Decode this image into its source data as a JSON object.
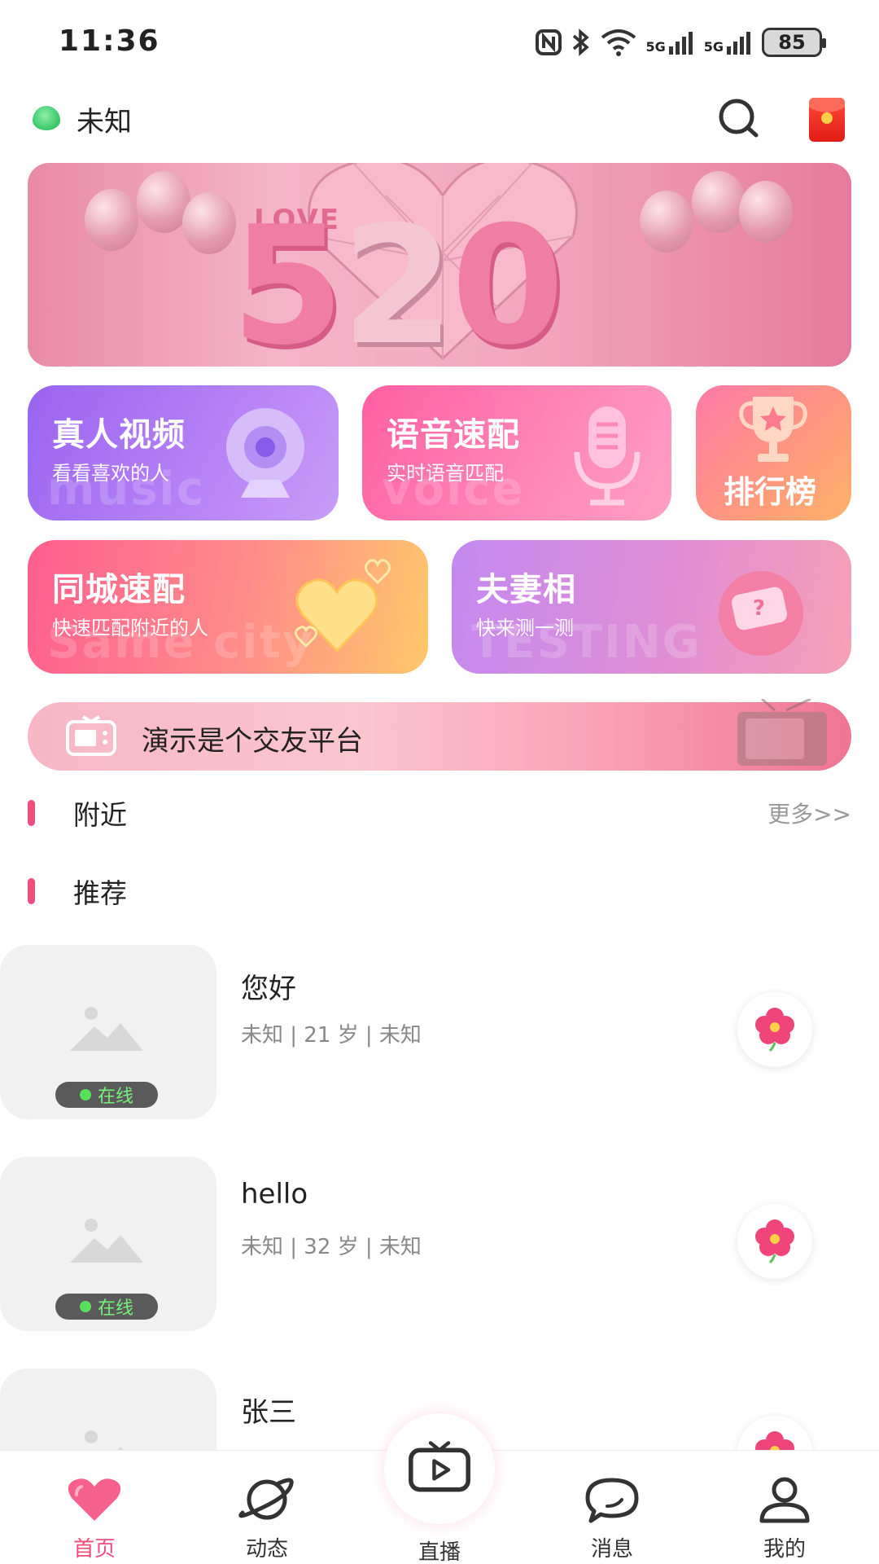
{
  "status_bar": {
    "time": "11:36",
    "network_1": "5G",
    "network_2": "5G",
    "battery": "85"
  },
  "header": {
    "location": "未知"
  },
  "banner": {
    "big_text_a": "5",
    "big_text_b": "2",
    "big_text_c": "0",
    "small_text": "LOVE"
  },
  "features": {
    "video": {
      "title": "真人视频",
      "subtitle": "看看喜欢的人",
      "watermark": "music"
    },
    "voice": {
      "title": "语音速配",
      "subtitle": "实时语音匹配",
      "watermark": "voice"
    },
    "rank": {
      "title": "排行榜"
    },
    "city": {
      "title": "同城速配",
      "subtitle": "快速匹配附近的人",
      "watermark": "Same city"
    },
    "couple": {
      "title": "夫妻相",
      "subtitle": "快来测一测",
      "watermark": "TESTING"
    }
  },
  "notice": {
    "text": "演示是个交友平台"
  },
  "sections": {
    "nearby": {
      "title": "附近",
      "more": "更多>>"
    },
    "recommend": {
      "title": "推荐"
    }
  },
  "users": [
    {
      "name": "您好",
      "meta": "未知 | 21 岁 | 未知",
      "status": "在线"
    },
    {
      "name": "hello",
      "meta": "未知 | 32 岁 | 未知",
      "status": "在线"
    },
    {
      "name": "张三",
      "meta": ""
    }
  ],
  "nav": [
    {
      "label": "首页",
      "icon": "heart-icon",
      "active": true
    },
    {
      "label": "动态",
      "icon": "planet-icon"
    },
    {
      "label": "直播",
      "icon": "play-tv-icon"
    },
    {
      "label": "消息",
      "icon": "chat-bubble-icon"
    },
    {
      "label": "我的",
      "icon": "user-icon"
    }
  ],
  "colors": {
    "accent": "#f14d7c",
    "online_dot": "#56e05c"
  }
}
